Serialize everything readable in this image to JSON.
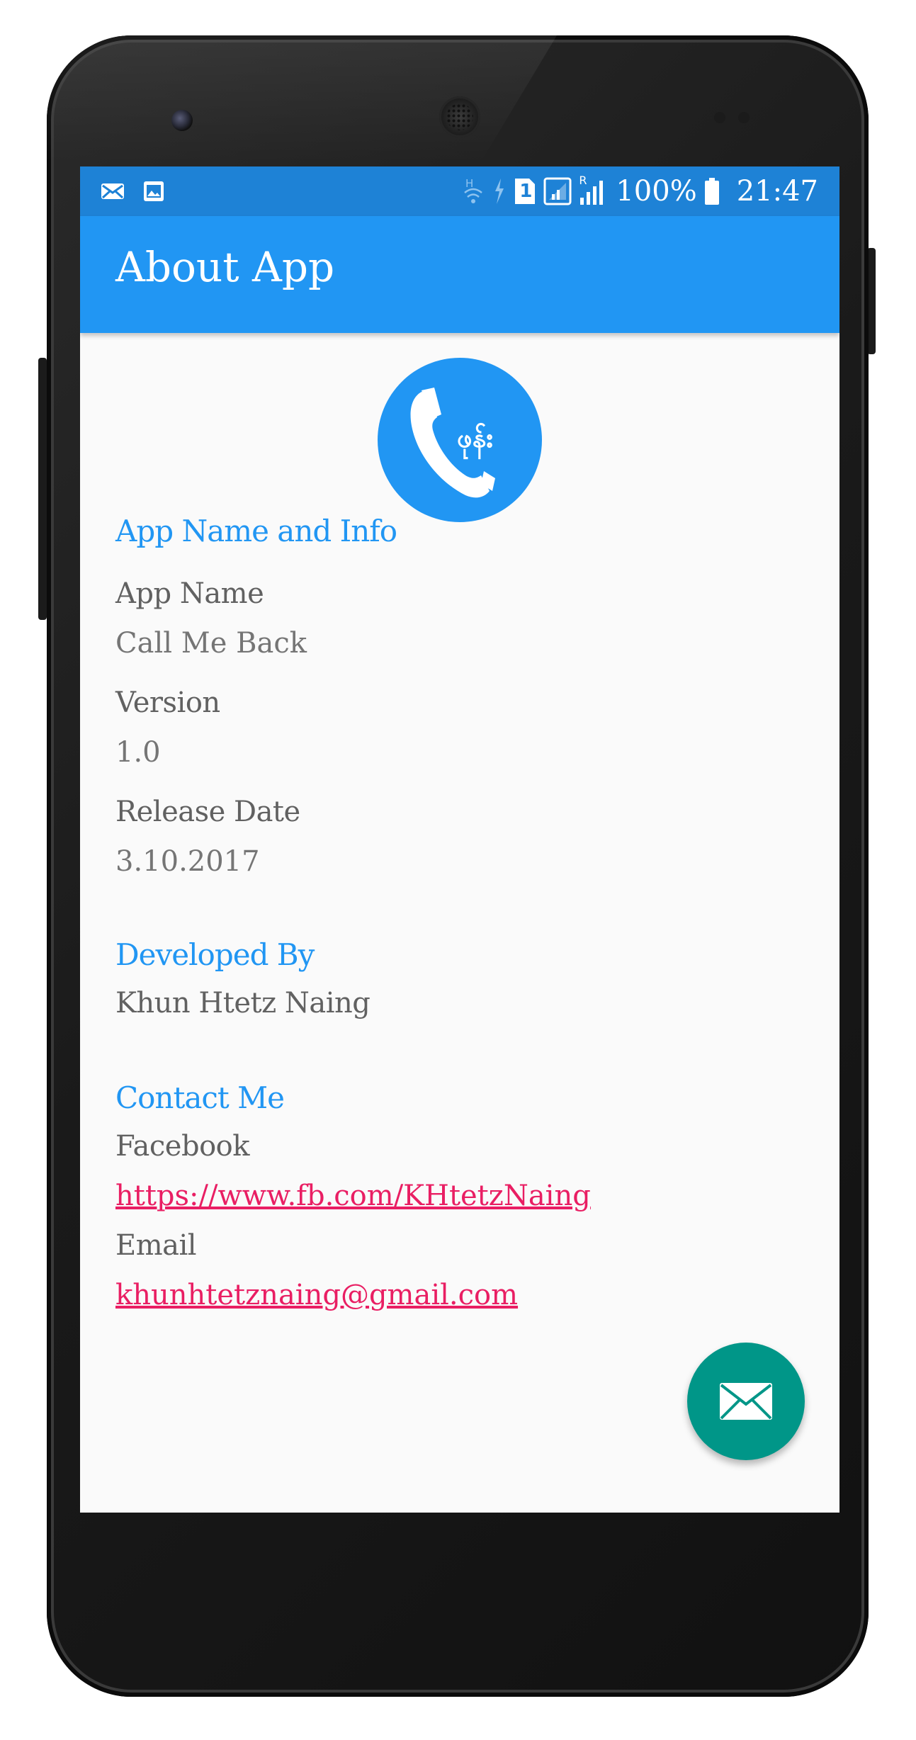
{
  "status_bar": {
    "battery_percent": "100%",
    "time": "21:47",
    "sim_slot": "1",
    "roaming_indicator": "R",
    "left_icons": [
      "mail-icon",
      "image-icon"
    ],
    "right_icons": [
      "wifi-h-icon",
      "data-transfer-icon",
      "sim-icon",
      "signal-icon",
      "signal-roaming-icon",
      "battery-icon"
    ]
  },
  "app_bar": {
    "title": "About App"
  },
  "logo": {
    "icon": "phone-call-logo-icon",
    "text": "ဖုန်း"
  },
  "sections": {
    "app_info": {
      "title": "App Name and Info",
      "app_name_label": "App Name",
      "app_name_value": "Call Me Back",
      "version_label": "Version",
      "version_value": "1.0",
      "release_label": "Release Date",
      "release_value": "3.10.2017"
    },
    "developer": {
      "title": "Developed By",
      "name": "Khun Htetz Naing"
    },
    "contact": {
      "title": "Contact Me",
      "facebook_label": "Facebook",
      "facebook_link": "https://www.fb.com/KHtetzNaing",
      "email_label": "Email",
      "email_link": "khunhtetznaing@gmail.com"
    }
  },
  "fab": {
    "icon": "envelope-icon"
  },
  "colors": {
    "status_bar": "#1e82d6",
    "primary": "#2196f3",
    "accent_link": "#e91e63",
    "fab": "#009688",
    "label": "#616161",
    "value": "#757575",
    "screen_bg": "#fafafa"
  }
}
